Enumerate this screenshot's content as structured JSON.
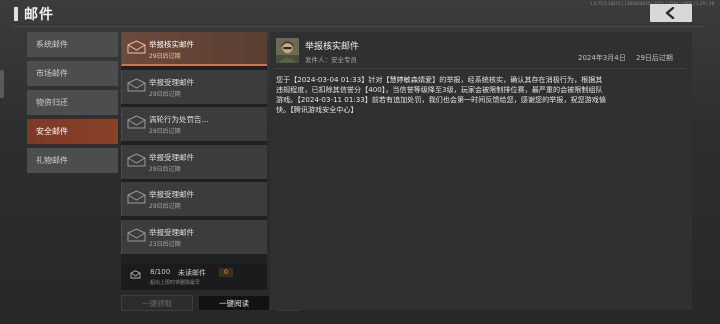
{
  "status_line": "1.0.75.0.18275 | 1365663010 | 1075 | 1584 | 1066 | 1.29 | 28",
  "header": {
    "title": "邮件"
  },
  "categories": [
    {
      "label": "系统邮件"
    },
    {
      "label": "市场邮件"
    },
    {
      "label": "物资归还"
    },
    {
      "label": "安全邮件"
    },
    {
      "label": "礼物邮件"
    }
  ],
  "mails": [
    {
      "subject": "举报核实邮件",
      "expire": "29日后过期"
    },
    {
      "subject": "举报受理邮件",
      "expire": "29日后过期"
    },
    {
      "subject": "涡轮行为处罚告...",
      "expire": "29日后过期"
    },
    {
      "subject": "举报受理邮件",
      "expire": "29日后过期"
    },
    {
      "subject": "举报受理邮件",
      "expire": "29日后过期"
    },
    {
      "subject": "举报受理邮件",
      "expire": "23日后过期"
    }
  ],
  "count_bar": {
    "count": "8/100",
    "unread_label": "未读邮件",
    "unread_count": "0",
    "hint": "超出上限时将删除最早"
  },
  "actions": {
    "claim_all": "一键领取",
    "read_all": "一键阅读"
  },
  "detail": {
    "title": "举报核实邮件",
    "sender": "发件人：安全专员",
    "date": "2024年3月4日",
    "expire": "29日后过期",
    "body_lines": [
      "您于【2024-03-04 01:33】针对【慧婷敏森婧爱】的举报，经系统核实，确认其存在消极行为，根据其",
      "违规程度，已扣除其信誉分【400】，当信誉等级降至3级，玩家会被限制排位赛，最严重的会被限制组队",
      "游戏。【2024-03-11 01:33】前若有追加处罚，我们也会第一时间反馈给您，感谢您的举报，祝您游戏愉",
      "快。【腾讯游戏安全中心】"
    ]
  },
  "icons": {
    "back": "chevron-left-icon",
    "mail": "envelope-icon",
    "delete": "trash-icon",
    "inbox": "inbox-icon"
  },
  "colors": {
    "accent": "#d8704a",
    "active_category": "#8a4128",
    "delete": "#e0502a"
  }
}
